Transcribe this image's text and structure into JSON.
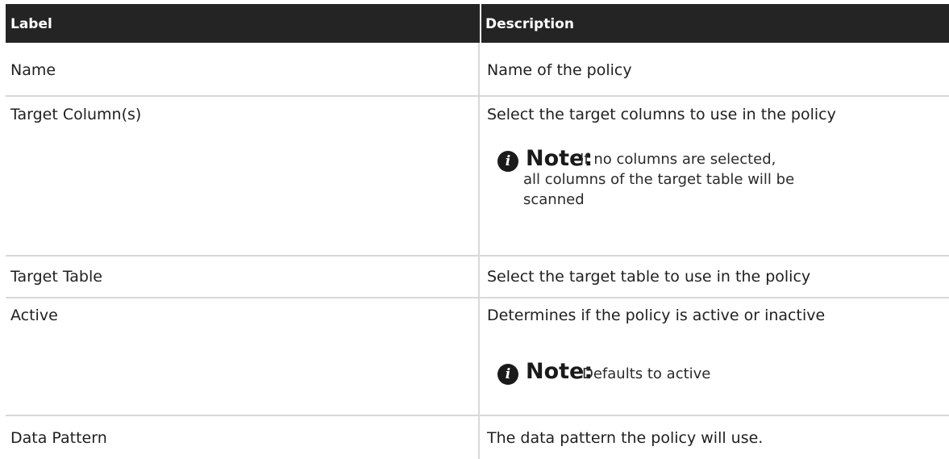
{
  "table": {
    "header": {
      "label": "Label",
      "description": "Description"
    },
    "rows": [
      {
        "label": "Name",
        "description": "Name of the policy"
      },
      {
        "label": "Target Column(s)",
        "description": "Select the target columns to use in the policy",
        "note": {
          "title": "Note:",
          "lines": [
            "If no columns are selected,",
            "all columns of the target table will be",
            "scanned"
          ]
        }
      },
      {
        "label": "Target Table",
        "description": "Select the target table to use in the policy"
      },
      {
        "label": "Active",
        "description": "Determines if the policy is active or inactive",
        "note": {
          "title": "Note:",
          "lines": [
            "Defaults to active"
          ]
        }
      },
      {
        "label": "Data Pattern",
        "description": "The data pattern the policy will use."
      }
    ]
  },
  "note_icon": "info-icon"
}
